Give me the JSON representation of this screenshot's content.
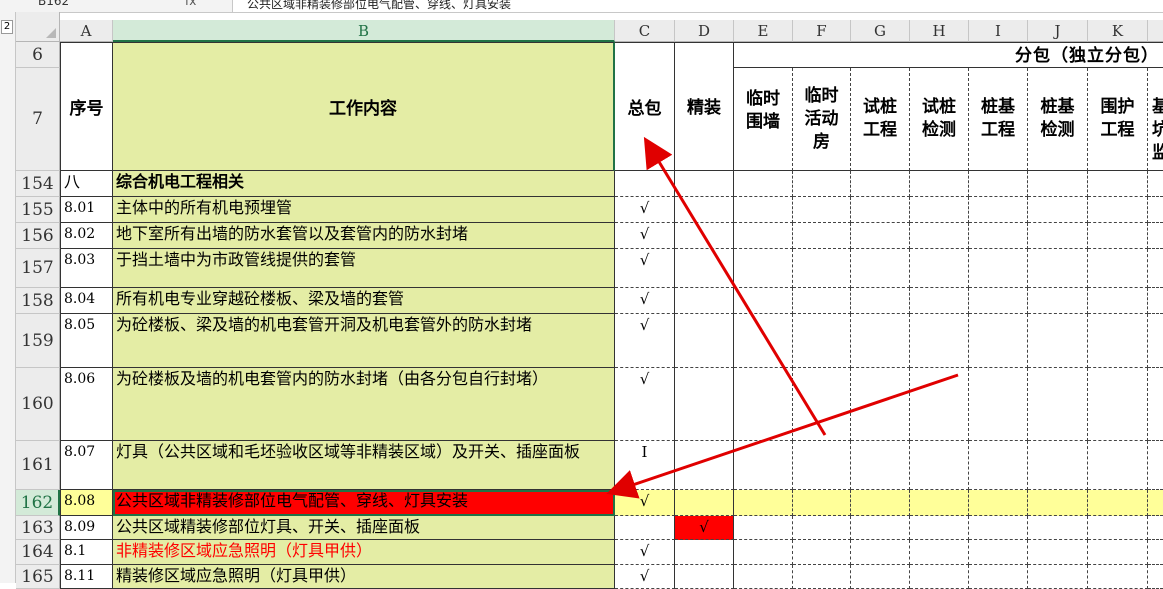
{
  "formula_bar": {
    "cell_ref": "B162",
    "fx_label": "fx",
    "formula_text": "公共区域非精装修部位电气配管、穿线、灯具安装"
  },
  "outline_levels": [
    "2"
  ],
  "columns": [
    "A",
    "B",
    "C",
    "D",
    "E",
    "F",
    "G",
    "H",
    "I",
    "J",
    "K"
  ],
  "selected_column": "B",
  "header_rows": {
    "row6": "6",
    "row7": "7",
    "seq": "序号",
    "work": "工作内容",
    "general": "总包",
    "finish": "精装",
    "subgroup": "分包（独立分包）",
    "sub_items": [
      "临时围墙",
      "临时活动房",
      "试桩工程",
      "试桩检测",
      "桩基工程",
      "桩基检测",
      "围护工程",
      "基坑监"
    ]
  },
  "rows": [
    {
      "num": "154",
      "seq": "八",
      "text": "综合机电工程相关",
      "c": "",
      "d": "",
      "style": "section"
    },
    {
      "num": "155",
      "seq": "8.01",
      "text": "主体中的所有机电预埋管",
      "c": "√",
      "d": ""
    },
    {
      "num": "156",
      "seq": "8.02",
      "text": "地下室所有出墙的防水套管以及套管内的防水封堵",
      "c": "√",
      "d": ""
    },
    {
      "num": "157",
      "seq": "8.03",
      "text": "于挡土墙中为市政管线提供的套管",
      "c": "√",
      "d": ""
    },
    {
      "num": "158",
      "seq": "8.04",
      "text": "所有机电专业穿越砼楼板、梁及墙的套管",
      "c": "√",
      "d": ""
    },
    {
      "num": "159",
      "seq": "8.05",
      "text": "为砼楼板、梁及墙的机电套管开洞及机电套管外的防水封堵",
      "c": "√",
      "d": ""
    },
    {
      "num": "160",
      "seq": "8.06",
      "text": "为砼楼板及墙的机电套管内的防水封堵（由各分包自行封堵）",
      "c": "√",
      "d": ""
    },
    {
      "num": "161",
      "seq": "8.07",
      "text": "灯具（公共区域和毛坯验收区域等非精装区域）及开关、插座面板",
      "c": "I",
      "d": ""
    },
    {
      "num": "162",
      "seq": "8.08",
      "text": "公共区域非精装修部位电气配管、穿线、灯具安装",
      "c": "√",
      "d": "",
      "style": "selected"
    },
    {
      "num": "163",
      "seq": "8.09",
      "text": "公共区域精装修部位灯具、开关、插座面板",
      "c": "",
      "d": "√"
    },
    {
      "num": "164",
      "seq": "8.1",
      "text": "非精装修区域应急照明（灯具甲供）",
      "c": "√",
      "d": "",
      "style": "redtext"
    },
    {
      "num": "165",
      "seq": "8.11",
      "text": "精装修区域应急照明（灯具甲供）",
      "c": "√",
      "d": ""
    }
  ],
  "colors": {
    "green_fill": "#e4eda5",
    "yellow_fill": "#ffff99",
    "red_fill": "#ff0000",
    "arrow": "#e00000",
    "selection": "#217346"
  }
}
